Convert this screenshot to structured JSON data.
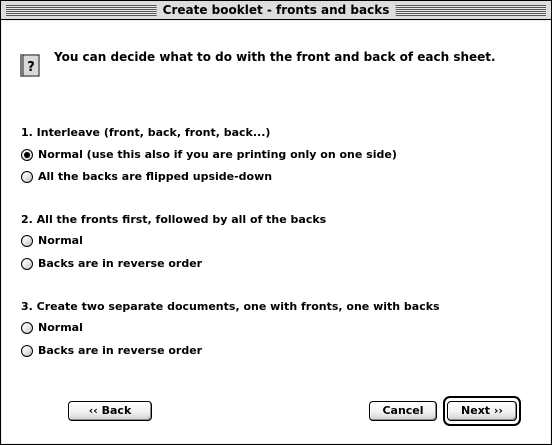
{
  "window": {
    "title": "Create booklet - fronts and backs"
  },
  "intro": {
    "icon": "question-document-icon",
    "text": "You can decide what to do with the front and back of each sheet."
  },
  "sections": [
    {
      "title": "1. Interleave (front, back, front, back...)",
      "options": [
        {
          "label": "Normal (use this also if you are printing only on one side)",
          "selected": true
        },
        {
          "label": "All the backs are flipped upside-down",
          "selected": false
        }
      ]
    },
    {
      "title": "2. All the fronts first, followed by all of the backs",
      "options": [
        {
          "label": "Normal",
          "selected": false
        },
        {
          "label": "Backs are in reverse order",
          "selected": false
        }
      ]
    },
    {
      "title": "3. Create two separate documents, one with fronts, one with backs",
      "options": [
        {
          "label": "Normal",
          "selected": false
        },
        {
          "label": "Backs are in reverse order",
          "selected": false
        }
      ]
    }
  ],
  "buttons": {
    "back": "‹‹ Back",
    "cancel": "Cancel",
    "next": "Next ››"
  }
}
